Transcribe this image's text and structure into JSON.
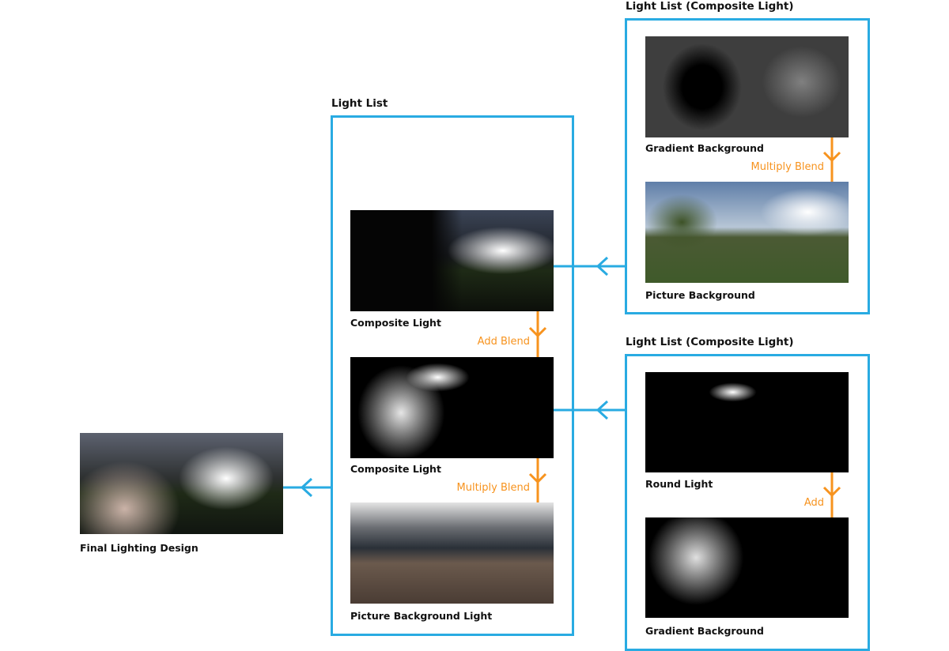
{
  "colors": {
    "connector": "#29abe2",
    "blend": "#f7931e"
  },
  "final": {
    "caption": "Final Lighting Design"
  },
  "main_list": {
    "title": "Light List",
    "items": [
      {
        "caption": "Composite Light"
      },
      {
        "caption": "Composite Light"
      },
      {
        "caption": "Picture Background Light"
      }
    ],
    "blends": [
      "Add Blend",
      "Multiply Blend"
    ]
  },
  "top_list": {
    "title": "Light List (Composite Light)",
    "items": [
      {
        "caption": "Gradient Background"
      },
      {
        "caption": "Picture Background"
      }
    ],
    "blends": [
      "Multiply Blend"
    ]
  },
  "bottom_list": {
    "title": "Light List (Composite Light)",
    "items": [
      {
        "caption": "Round Light"
      },
      {
        "caption": "Gradient Background"
      }
    ],
    "blends": [
      "Add"
    ]
  }
}
